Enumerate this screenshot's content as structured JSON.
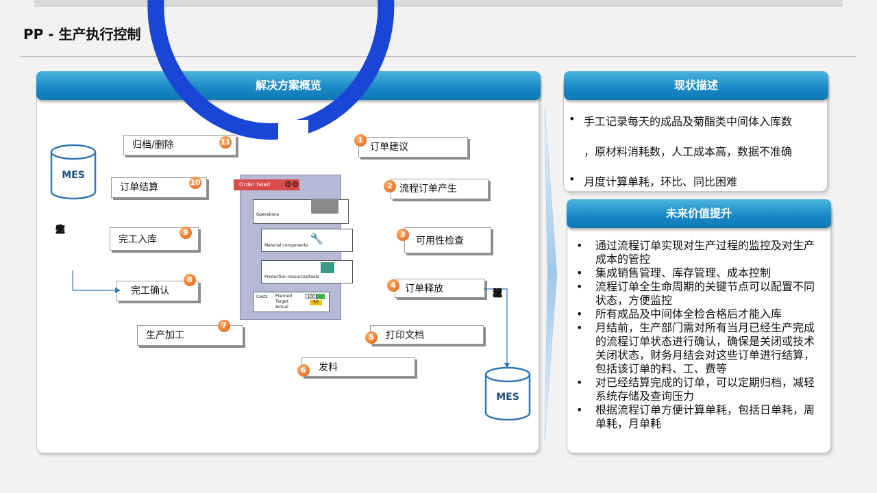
{
  "page": {
    "title": "PP - 生产执行控制"
  },
  "solution": {
    "header": "解决方案概览",
    "steps": [
      {
        "num": "1",
        "label": "订单建议"
      },
      {
        "num": "2",
        "label": "流程订单产生"
      },
      {
        "num": "3",
        "label": "可用性检查"
      },
      {
        "num": "4",
        "label": "订单释放"
      },
      {
        "num": "5",
        "label": "打印文档"
      },
      {
        "num": "6",
        "label": "发料"
      },
      {
        "num": "7",
        "label": "生产加工"
      },
      {
        "num": "8",
        "label": "完工确认"
      },
      {
        "num": "9",
        "label": "完工入库"
      },
      {
        "num": "10",
        "label": "订单结算"
      },
      {
        "num": "11",
        "label": "归档/删除"
      }
    ],
    "order_card": {
      "head": "Order head",
      "operations": "Operations",
      "material": "Material components",
      "production": "Production resources/tools",
      "costs": "Costs",
      "planned": "Planned",
      "target": "Target",
      "actual": "Actual",
      "val1": "100",
      "val2": "50"
    },
    "mes_top": "MES",
    "mes_bottom": "MES",
    "left_flow_label": [
      "完",
      "工",
      "信",
      "息"
    ],
    "right_flow_label": [
      "流",
      "程",
      "订",
      "单"
    ]
  },
  "status": {
    "header": "现状描述",
    "items": [
      "手工记录每天的成品及菊酯类中间体入库数",
      "，原材料消耗数，人工成本高，数据不准确",
      "月度计算单耗，环比、同比困难"
    ]
  },
  "future": {
    "header": "未来价值提升",
    "items": [
      "通过流程订单实现对生产过程的监控及对生产成本的管控",
      "集成销售管理、库存管理、成本控制",
      "流程订单全生命周期的关键节点可以配置不同状态，方便监控",
      "所有成品及中间体全检合格后才能入库",
      "月结前，生产部门需对所有当月已经生产完成的流程订单状态进行确认，确保是关闭或技术关闭状态，财务月结会对这些订单进行结算，包括该订单的料、工、费等",
      "对已经结算完成的订单，可以定期归档，减轻系统存储及查询压力",
      "根据流程订单方便计算单耗，包括日单耗，周单耗，月单耗"
    ]
  },
  "colors": {
    "ring": "#1a46d8",
    "header": "#1a8ac6",
    "step_badge": "#e0580d"
  }
}
